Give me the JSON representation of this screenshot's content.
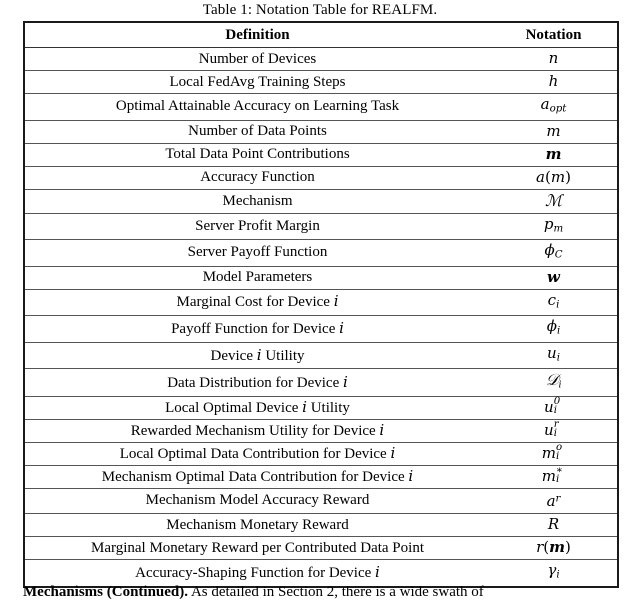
{
  "caption": {
    "prefix": "Table 1: Notation Table for ",
    "system_name_head": "R",
    "system_name_small": "EAL",
    "system_name_tail": "FM",
    "suffix": "."
  },
  "table": {
    "headers": [
      "Definition",
      "Notation"
    ],
    "rows": [
      {
        "definition": "Number of Devices",
        "notation": "n"
      },
      {
        "definition": "Local FedAvg Training Steps",
        "notation": "h"
      },
      {
        "definition": "Optimal Attainable Accuracy on Learning Task",
        "notation": "a_opt"
      },
      {
        "definition": "Number of Data Points",
        "notation": "m"
      },
      {
        "definition": "Total Data Point Contributions",
        "notation": "m (bold)"
      },
      {
        "definition": "Accuracy Function",
        "notation": "a(m)"
      },
      {
        "definition": "Mechanism",
        "notation": "M (calligraphic)"
      },
      {
        "definition": "Server Profit Margin",
        "notation": "p_m"
      },
      {
        "definition": "Server Payoff Function",
        "notation": "phi_C"
      },
      {
        "definition": "Model Parameters",
        "notation": "w (bold)"
      },
      {
        "definition": "Marginal Cost for Device i",
        "notation": "c_i"
      },
      {
        "definition": "Payoff Function for Device i",
        "notation": "phi_i"
      },
      {
        "definition": "Device i Utility",
        "notation": "u_i"
      },
      {
        "definition": "Data Distribution for Device i",
        "notation": "D_i (calligraphic)"
      },
      {
        "definition": "Local Optimal Device i Utility",
        "notation": "u_i^0"
      },
      {
        "definition": "Rewarded Mechanism Utility for Device i",
        "notation": "u_i^r"
      },
      {
        "definition": "Local Optimal Data Contribution for Device i",
        "notation": "m_i^o"
      },
      {
        "definition": "Mechanism Optimal Data Contribution for Device i",
        "notation": "m_i^*"
      },
      {
        "definition": "Mechanism Model Accuracy Reward",
        "notation": "a^r"
      },
      {
        "definition": "Mechanism Monetary Reward",
        "notation": "R"
      },
      {
        "definition": "Marginal Monetary Reward per Contributed Data Point",
        "notation": "r(m) (bold m)"
      },
      {
        "definition": "Accuracy-Shaping Function for Device i",
        "notation": "gamma_i"
      }
    ]
  },
  "body_paragraph": {
    "heading": "Mechanisms (Continued).",
    "text": " As detailed in Section 2, there is a wide swath of"
  }
}
